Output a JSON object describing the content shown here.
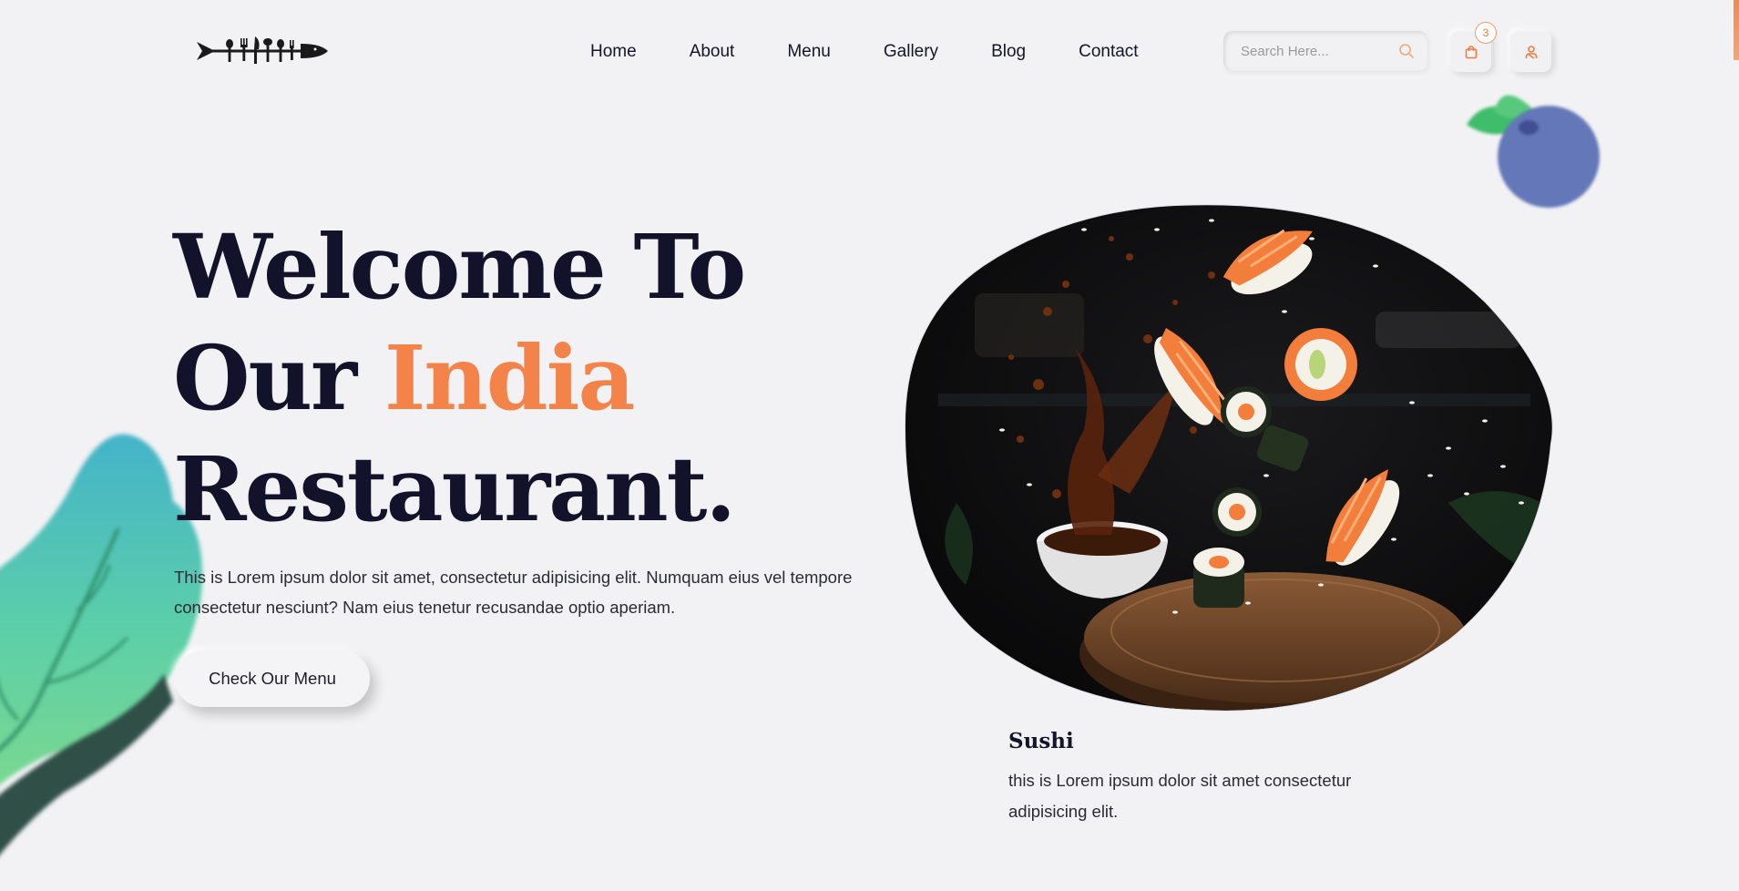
{
  "nav": {
    "items": [
      {
        "label": "Home"
      },
      {
        "label": "About"
      },
      {
        "label": "Menu"
      },
      {
        "label": "Gallery"
      },
      {
        "label": "Blog"
      },
      {
        "label": "Contact"
      }
    ]
  },
  "search": {
    "placeholder": "Search Here...",
    "icon": "search-icon"
  },
  "cart": {
    "icon": "shopping-bag-icon",
    "count": "3"
  },
  "user": {
    "icon": "user-icon"
  },
  "hero": {
    "title_line1": "Welcome To",
    "title_line2_prefix": "Our ",
    "title_line2_accent": "India",
    "title_line3": "Restaurant.",
    "description": "This is Lorem ipsum dolor sit amet, consectetur adipisicing elit. Numquam eius vel tempore consectetur nesciunt? Nam eius tenetur recusandae optio aperiam.",
    "button_label": "Check Our Menu"
  },
  "feature": {
    "title": "Sushi",
    "description": "this is Lorem ipsum dolor sit amet consectetur adipisicing elit."
  },
  "colors": {
    "accent": "#f4834a",
    "text_dark": "#12122a",
    "background": "#f2f2f4"
  }
}
